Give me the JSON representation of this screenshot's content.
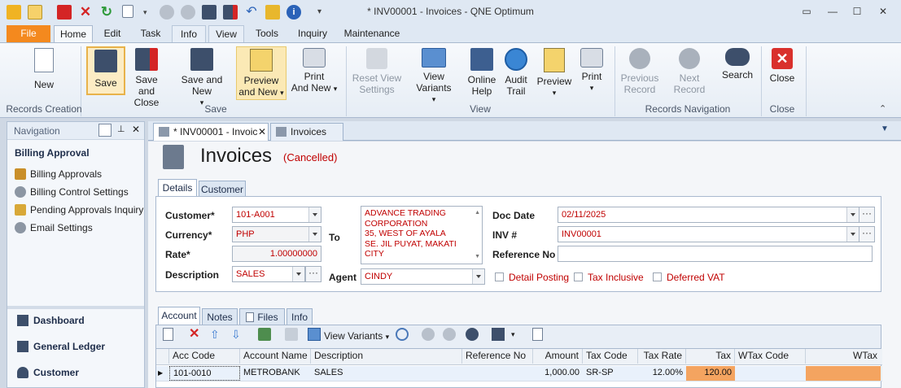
{
  "window": {
    "title": "* INV00001 - Invoices - QNE Optimum"
  },
  "colors": {
    "accent": "#f4891e",
    "required_text": "#c00000",
    "ribbon_bg": "#f1f5fa",
    "tax_cell": "#f4a460",
    "highlight_border": "#e8b24a"
  },
  "quick_access": {
    "icons": [
      "app-icon",
      "menu-icon",
      "pdf-icon",
      "close-icon",
      "refresh-icon",
      "new-icon",
      "dropdown-icon",
      "up-icon",
      "down-icon",
      "save-icon",
      "save-close-icon",
      "undo-icon",
      "edit-icon",
      "info-icon",
      "customize-icon"
    ]
  },
  "ribbon_tabs": [
    "File",
    "Home",
    "Edit",
    "Task",
    "Info",
    "View",
    "Tools",
    "Inquiry",
    "Maintenance"
  ],
  "ribbon": {
    "new": "New",
    "save": "Save",
    "save_and_close": [
      "Save and",
      "Close"
    ],
    "save_and_new": "Save and New",
    "preview_and_new": [
      "Preview",
      "and New"
    ],
    "print_and_new": [
      "Print",
      "And New"
    ],
    "reset_view": [
      "Reset View",
      "Settings"
    ],
    "view_variants": "View Variants",
    "online_help": [
      "Online",
      "Help"
    ],
    "audit_trail": [
      "Audit",
      "Trail"
    ],
    "preview": "Preview",
    "print": "Print",
    "previous_record": [
      "Previous",
      "Record"
    ],
    "next_record": "Next Record",
    "search": "Search",
    "close": "Close",
    "groups": {
      "records_creation": "Records Creation",
      "save": "Save",
      "view": "View",
      "records_navigation": "Records Navigation",
      "close": "Close"
    }
  },
  "navigation": {
    "header": "Navigation",
    "section": "Billing Approval",
    "items": [
      {
        "label": "Billing Approvals",
        "icon": "billing-icon"
      },
      {
        "label": "Billing Control Settings",
        "icon": "gear-icon"
      },
      {
        "label": "Pending Approvals Inquiry",
        "icon": "pending-icon"
      },
      {
        "label": "Email Settings",
        "icon": "gear-icon"
      }
    ],
    "modules": [
      {
        "label": "Dashboard",
        "icon": "dashboard-icon"
      },
      {
        "label": "General Ledger",
        "icon": "ledger-icon"
      },
      {
        "label": "Customer",
        "icon": "customer-icon"
      }
    ]
  },
  "doc_tabs": [
    {
      "label": "* INV00001 - Invoic",
      "active": true
    },
    {
      "label": "Invoices",
      "active": false
    }
  ],
  "form": {
    "title": "Invoices",
    "status": "(Cancelled)",
    "tabs": [
      "Details",
      "Customer"
    ],
    "customer_label": "Customer*",
    "customer_value": "101-A001",
    "currency_label": "Currency*",
    "currency_value": "PHP",
    "rate_label": "Rate*",
    "rate_value": "1.00000000",
    "description_label": "Description",
    "description_value": "SALES",
    "to_label": "To",
    "to_address": [
      "ADVANCE TRADING",
      "CORPORATION",
      "35, WEST OF AYALA",
      "SE. JIL PUYAT, MAKATI",
      "CITY"
    ],
    "agent_label": "Agent",
    "agent_value": "CINDY",
    "doc_date_label": "Doc Date",
    "doc_date_value": "02/11/2025",
    "inv_label": "INV #",
    "inv_value": "INV00001",
    "reference_label": "Reference No",
    "reference_value": "",
    "detail_posting": "Detail Posting",
    "tax_inclusive": "Tax Inclusive",
    "deferred_vat": "Deferred VAT"
  },
  "detail_tabs": [
    "Account",
    "Notes",
    "Files",
    "Info"
  ],
  "grid_toolbar": {
    "view_variants": "View Variants"
  },
  "grid": {
    "columns": [
      "Acc Code",
      "Account Name",
      "Description",
      "Reference No",
      "Amount",
      "Tax Code",
      "Tax Rate",
      "Tax",
      "WTax Code",
      "WTax"
    ],
    "rows": [
      [
        "101-0010",
        "METROBANK",
        "SALES",
        "",
        "1,000.00",
        "SR-SP",
        "12.00%",
        "120.00",
        "",
        ""
      ]
    ]
  }
}
